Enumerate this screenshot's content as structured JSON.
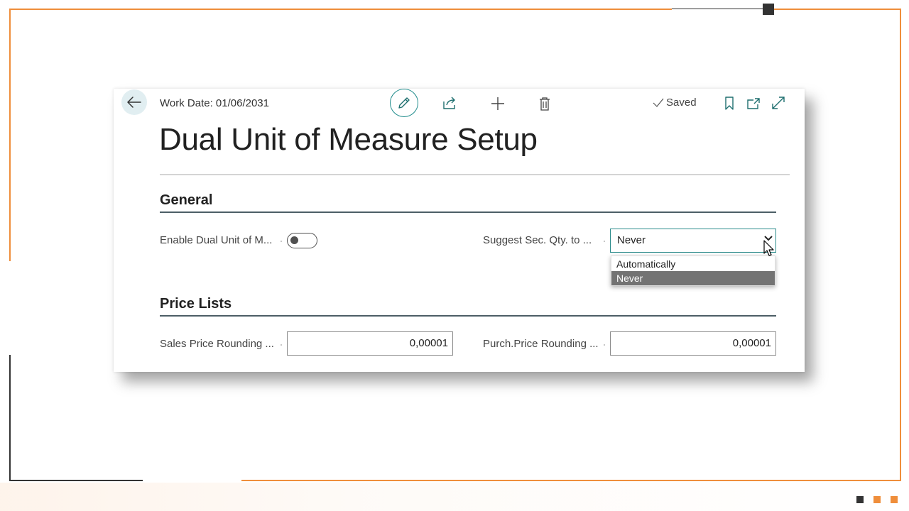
{
  "colors": {
    "frame_orange": "#ef8e3b",
    "frame_dark": "#333333",
    "accent_teal": "#1e8b8b",
    "selected_option_bg": "#737373"
  },
  "slide": {
    "dots": [
      "#333333",
      "#ef8e3b",
      "#ef8e3b"
    ]
  },
  "header": {
    "back_icon": "arrow-left-icon",
    "work_date": "Work Date: 01/06/2031",
    "actions": [
      "pencil-icon",
      "share-icon",
      "plus-icon",
      "trash-icon"
    ],
    "status": "Saved",
    "status_icon": "checkmark-icon",
    "right_actions": [
      "bookmark-icon",
      "open-new-window-icon",
      "expand-icon"
    ]
  },
  "page": {
    "title": "Dual Unit of Measure Setup"
  },
  "general": {
    "heading": "General",
    "enable_label": "Enable Dual Unit of M...",
    "enable_value": false,
    "suggest_label": "Suggest Sec. Qty. to ...",
    "suggest_value": "Never",
    "suggest_options": [
      "Automatically",
      "Never"
    ],
    "suggest_selected_index": 1
  },
  "price_lists": {
    "heading": "Price Lists",
    "sales_label": "Sales Price Rounding ...",
    "sales_value": "0,00001",
    "purch_label": "Purch.Price Rounding ...",
    "purch_value": "0,00001"
  }
}
